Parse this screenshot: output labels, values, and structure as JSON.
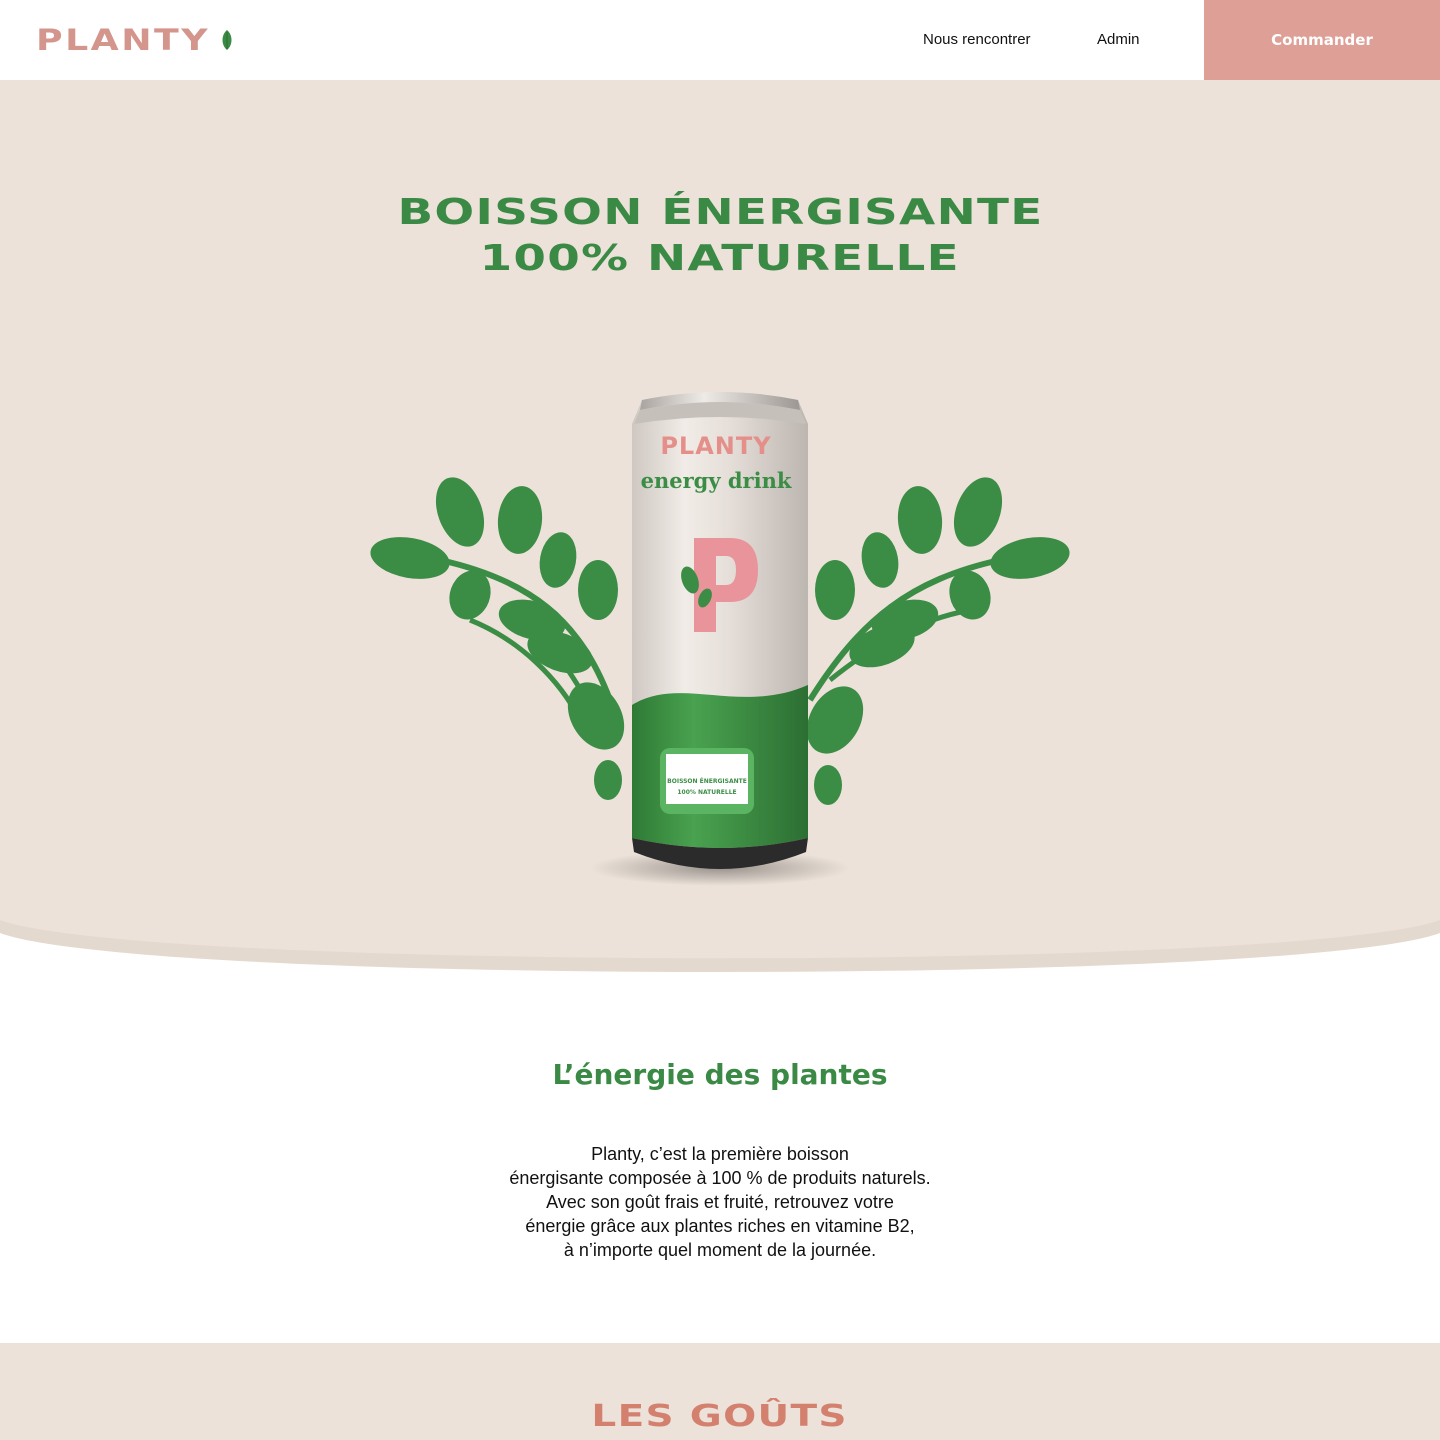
{
  "brand": {
    "name": "PLANTY",
    "colors": {
      "pink": "#de9f96",
      "green": "#3a8a45",
      "beige": "#ece2d9"
    }
  },
  "nav": {
    "links": [
      {
        "label": "Nous rencontrer"
      },
      {
        "label": "Admin"
      }
    ],
    "cta_label": "Commander"
  },
  "hero": {
    "title_line1": "BOISSON ÉNERGISANTE",
    "title_line2": "100% NATURELLE",
    "can": {
      "brand": "PLANTY",
      "subtitle": "energy drink",
      "letter": "P",
      "badge_line1": "BOISSON ÉNERGISANTE",
      "badge_line2": "100% NATURELLE"
    }
  },
  "about": {
    "title": "L’énergie des plantes",
    "lines": [
      "Planty, c’est la première boisson",
      "énergisante composée à 100 % de produits naturels.",
      "Avec son goût frais et fruité, retrouvez votre",
      "énergie grâce aux plantes riches en vitamine B2,",
      "à n’importe quel moment de la journée."
    ]
  },
  "flavors": {
    "title": "LES GOÛTS"
  }
}
